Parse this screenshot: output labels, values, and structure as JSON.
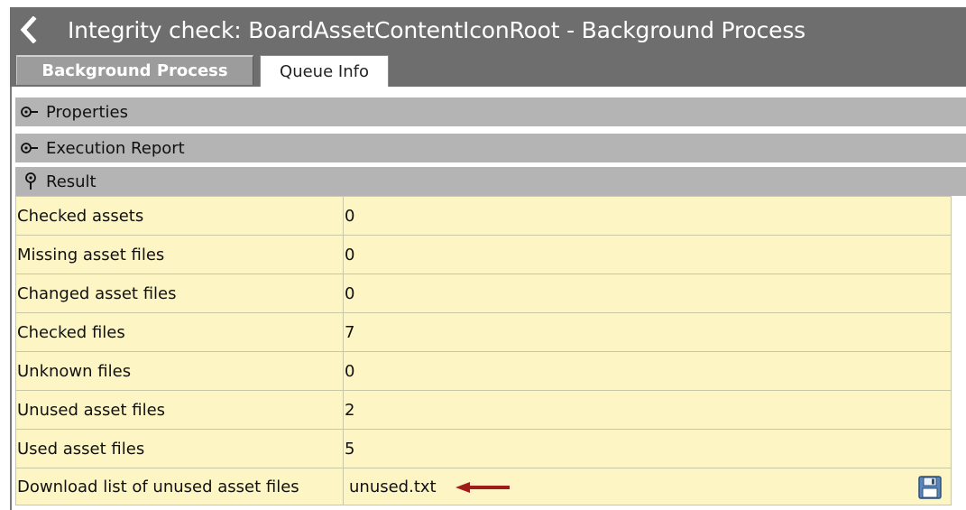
{
  "window": {
    "title": "Integrity check: BoardAssetContentIconRoot - Background Process"
  },
  "tabs": [
    {
      "label": "Background Process",
      "active": true
    },
    {
      "label": "Queue Info",
      "active": false
    }
  ],
  "sections": {
    "properties": {
      "label": "Properties",
      "expanded": false
    },
    "execution_report": {
      "label": "Execution Report",
      "expanded": false
    },
    "result": {
      "label": "Result",
      "expanded": true
    }
  },
  "result": {
    "rows": [
      {
        "key": "Checked assets",
        "value": "0"
      },
      {
        "key": "Missing asset files",
        "value": "0"
      },
      {
        "key": "Changed asset files",
        "value": "0"
      },
      {
        "key": "Checked files",
        "value": "7"
      },
      {
        "key": "Unknown files",
        "value": "0"
      },
      {
        "key": "Unused asset files",
        "value": "2"
      },
      {
        "key": "Used asset files",
        "value": "5"
      }
    ],
    "download": {
      "key": "Download list of unused asset files",
      "value": "unused.txt"
    }
  },
  "icons": {
    "back": "chevron-left-icon",
    "collapsed": "collapsed-pin-icon",
    "expanded": "expanded-pin-icon",
    "annotation_arrow": "left-arrow-icon",
    "save": "floppy-disk-icon"
  },
  "colors": {
    "header_bg": "#6e6e6e",
    "section_bg": "#b4b4b4",
    "row_bg": "#fdf5c4",
    "annotation_arrow": "#a01c1c"
  }
}
